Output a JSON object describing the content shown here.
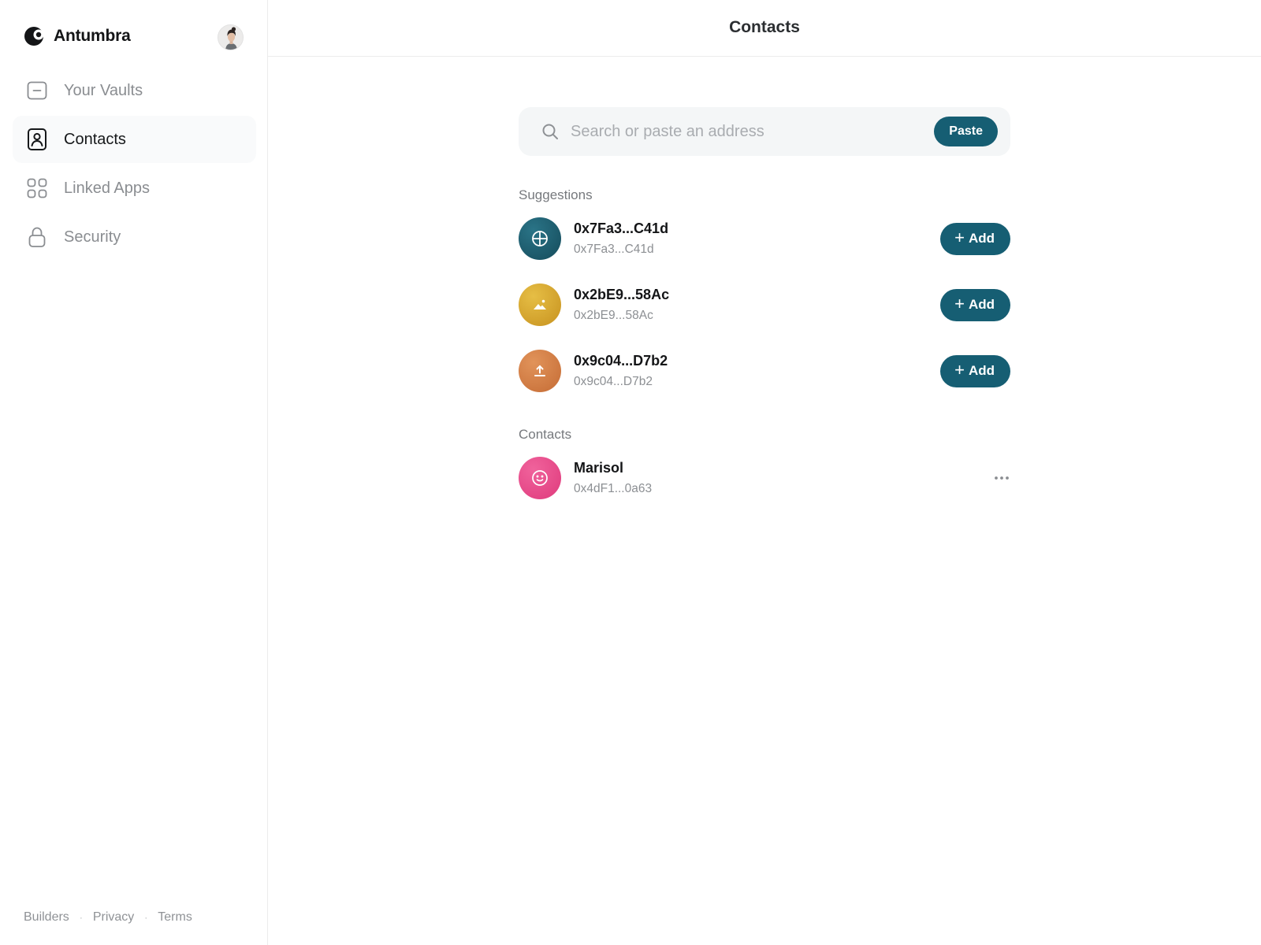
{
  "app": {
    "brand_name": "Antumbra"
  },
  "sidebar": {
    "items": [
      {
        "label": "Your Vaults",
        "icon": "vault-icon",
        "active": false
      },
      {
        "label": "Contacts",
        "icon": "contact-card-icon",
        "active": true
      },
      {
        "label": "Linked Apps",
        "icon": "apps-grid-icon",
        "active": false
      },
      {
        "label": "Security",
        "icon": "lock-icon",
        "active": false
      }
    ],
    "footer": {
      "links": [
        "Builders",
        "Privacy",
        "Terms"
      ],
      "separator": "·"
    }
  },
  "header": {
    "title": "Contacts"
  },
  "search": {
    "placeholder": "Search or paste an address",
    "value": "",
    "paste_label": "Paste"
  },
  "suggestions": {
    "label": "Suggestions",
    "add_label": "Add",
    "items": [
      {
        "name": "0x7Fa3...C41d",
        "address": "0x7Fa3...C41d",
        "icon": "globe-icon",
        "color": "#1f6274"
      },
      {
        "name": "0x2bE9...58Ac",
        "address": "0x2bE9...58Ac",
        "icon": "mountain-icon",
        "color": "#d3a52c"
      },
      {
        "name": "0x9c04...D7b2",
        "address": "0x9c04...D7b2",
        "icon": "upload-icon",
        "color": "#d47f46"
      }
    ]
  },
  "contacts": {
    "label": "Contacts",
    "items": [
      {
        "name": "Marisol",
        "address": "0x4dF1...0a63",
        "icon": "smiley-icon",
        "color": "#e84686"
      }
    ]
  },
  "colors": {
    "accent": "#165e73",
    "active_nav_bg": "#f9fafb",
    "search_bg": "#f4f6f7"
  }
}
